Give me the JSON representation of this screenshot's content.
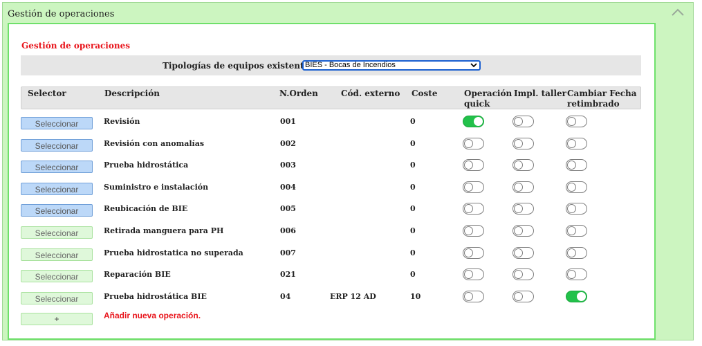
{
  "panel": {
    "title": "Gestión de operaciones"
  },
  "section": {
    "title": "Gestión de operaciones"
  },
  "typology": {
    "label": "Tipologías de equipos existentes",
    "selected": "BIES - Bocas de Incendios"
  },
  "table": {
    "headers": {
      "selector": "Selector",
      "descripcion": "Descripción",
      "orden": "N.Orden",
      "externo": "Cód. externo",
      "coste": "Coste",
      "quick_line1": "Operación",
      "quick_line2": "quick",
      "taller": "Impl. taller",
      "retimbrado_line1": "Cambiar Fecha",
      "retimbrado_line2": "retimbrado"
    },
    "rows": [
      {
        "button": "Seleccionar",
        "button_style": "blue",
        "descripcion": "Revisión",
        "orden": "001",
        "externo": "",
        "coste": "0",
        "quick": true,
        "taller": false,
        "retimbrado": false
      },
      {
        "button": "Seleccionar",
        "button_style": "blue",
        "descripcion": "Revisión con anomalías",
        "orden": "002",
        "externo": "",
        "coste": "0",
        "quick": false,
        "taller": false,
        "retimbrado": false
      },
      {
        "button": "Seleccionar",
        "button_style": "blue",
        "descripcion": "Prueba hidrostática",
        "orden": "003",
        "externo": "",
        "coste": "0",
        "quick": false,
        "taller": false,
        "retimbrado": false
      },
      {
        "button": "Seleccionar",
        "button_style": "blue",
        "descripcion": "Suministro e instalación",
        "orden": "004",
        "externo": "",
        "coste": "0",
        "quick": false,
        "taller": false,
        "retimbrado": false
      },
      {
        "button": "Seleccionar",
        "button_style": "blue",
        "descripcion": "Reubicación de BIE",
        "orden": "005",
        "externo": "",
        "coste": "0",
        "quick": false,
        "taller": false,
        "retimbrado": false
      },
      {
        "button": "Seleccionar",
        "button_style": "green",
        "descripcion": "Retirada manguera para PH",
        "orden": "006",
        "externo": "",
        "coste": "0",
        "quick": false,
        "taller": false,
        "retimbrado": false
      },
      {
        "button": "Seleccionar",
        "button_style": "green",
        "descripcion": "Prueba hidrostatica no superada",
        "orden": "007",
        "externo": "",
        "coste": "0",
        "quick": false,
        "taller": false,
        "retimbrado": false
      },
      {
        "button": "Seleccionar",
        "button_style": "green",
        "descripcion": "Reparación BIE",
        "orden": "021",
        "externo": "",
        "coste": "0",
        "quick": false,
        "taller": false,
        "retimbrado": false
      },
      {
        "button": "Seleccionar",
        "button_style": "green",
        "descripcion": "Prueba hidrostática BIE",
        "orden": "04",
        "externo": "ERP 12 AD",
        "coste": "10",
        "quick": false,
        "taller": false,
        "retimbrado": true
      }
    ]
  },
  "actions": {
    "add_button": "+",
    "add_link": "Añadir nueva operación."
  },
  "colors": {
    "panel_bg": "#ccf5c0",
    "inner_border": "#6ee06a",
    "accent_red": "#e8141b",
    "toggle_on": "#22c14a",
    "button_blue": "#bcd8f8",
    "button_green": "#dff8da"
  },
  "icons": {
    "collapse": "chevron-up-icon",
    "select_arrow": "chevron-down-icon"
  }
}
